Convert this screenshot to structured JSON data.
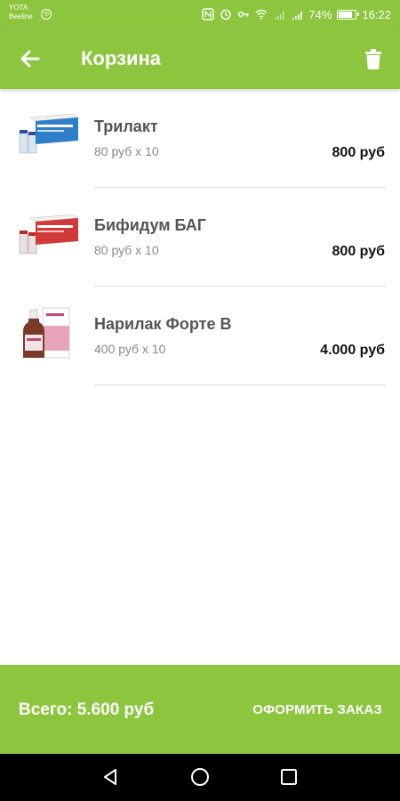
{
  "status_bar": {
    "carrier_1": "YOTA",
    "carrier_2": "Beeline",
    "battery": "74%",
    "time": "16:22"
  },
  "app_bar": {
    "title": "Корзина",
    "back_icon": "arrow-left-icon",
    "delete_icon": "trash-icon"
  },
  "items": [
    {
      "name": "Трилакт",
      "qty": "80 руб x 10",
      "price": "800 руб",
      "image": "blue-box-with-vials"
    },
    {
      "name": "Бифидум БАГ",
      "qty": "80 руб x 10",
      "price": "800 руб",
      "image": "red-box-with-vials"
    },
    {
      "name": "Нарилак Форте В",
      "qty": "400 руб x 10",
      "price": "4.000 руб",
      "image": "bottle-with-box"
    }
  ],
  "footer": {
    "total": "Всего: 5.600 руб",
    "checkout": "ОФОРМИТЬ ЗАКАЗ"
  },
  "colors": {
    "primary": "#8cc63f",
    "text_dark": "#555555",
    "nav": "#000000"
  }
}
